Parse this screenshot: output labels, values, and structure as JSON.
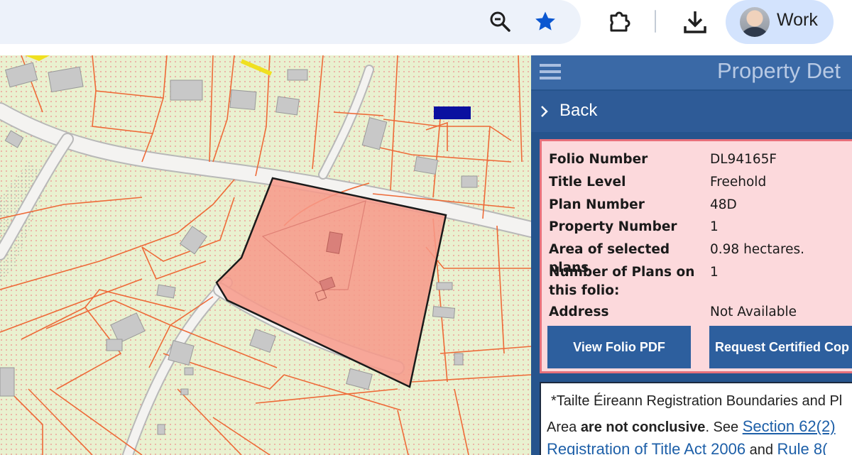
{
  "browser": {
    "profile_name": "Work",
    "icons": {
      "zoom": "zoom-out-icon",
      "bookmark": "bookmark-star-icon",
      "extensions": "puzzle-piece-icon",
      "downloads": "download-icon"
    }
  },
  "panel": {
    "title": "Property Det",
    "back_label": "Back",
    "details": [
      {
        "label": "Folio Number",
        "value": "DL94165F"
      },
      {
        "label": "Title Level",
        "value": "Freehold"
      },
      {
        "label": "Plan Number",
        "value": "48D"
      },
      {
        "label": "Property Number",
        "value": "1"
      },
      {
        "label": "Area of selected plans",
        "value": "0.98 hectares."
      },
      {
        "label": "Number of Plans on",
        "label2": "this folio:",
        "value": "1"
      },
      {
        "label": "Address",
        "value": "Not Available"
      }
    ],
    "buttons": {
      "view_pdf": "View Folio PDF",
      "request_copy": "Request Certified Cop"
    },
    "disclaimer": {
      "line1": "*Tailte Éireann Registration Boundaries and Pl",
      "line2_prefix": "Area ",
      "line2_bold": "are not conclusive",
      "line2_suffix": ". See ",
      "link1": "Section 62(2)",
      "link2": "Registration of Title Act 2006",
      "line3_mid": " and ",
      "link3": "Rule 8("
    }
  },
  "colors": {
    "panel_bg": "#26548d",
    "panel_header": "#3a69a6",
    "card_bg": "#fcd9dc",
    "card_border": "#e7707b",
    "button_bg": "#2d5f9e",
    "map_bg": "#e9f1d0",
    "parcel_line": "#ee6a38",
    "road": "#f4f3f1",
    "selected_fill": "#f7998a",
    "accent_star": "#0b57d0",
    "profile_chip": "#d3e3fd"
  }
}
